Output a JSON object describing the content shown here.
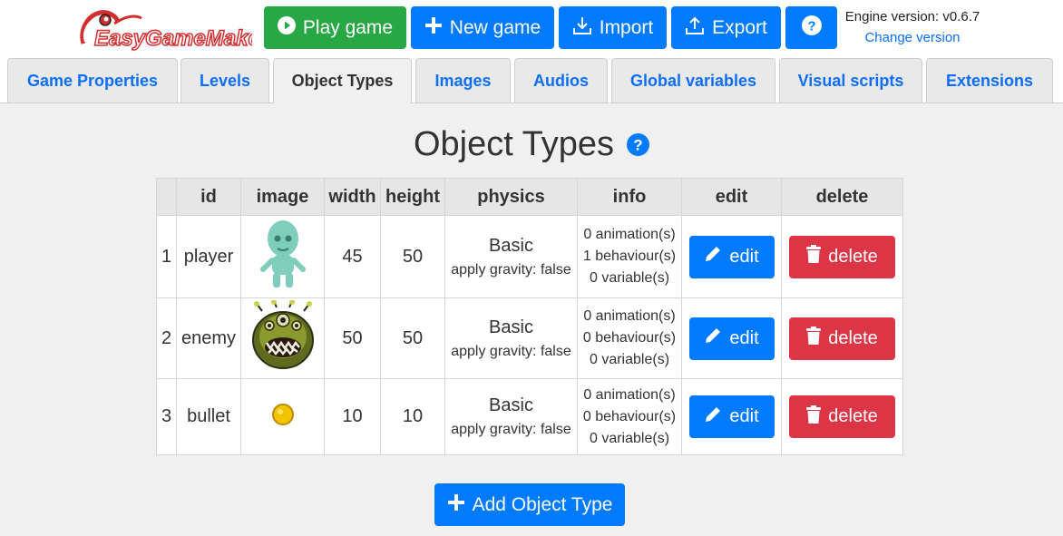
{
  "header": {
    "logo_text": "EasyGameMaker",
    "play_label": "Play game",
    "new_label": "New game",
    "import_label": "Import",
    "export_label": "Export",
    "engine_version": "Engine version: v0.6.7",
    "change_version": "Change version"
  },
  "tabs": [
    {
      "label": "Game Properties",
      "active": false
    },
    {
      "label": "Levels",
      "active": false
    },
    {
      "label": "Object Types",
      "active": true
    },
    {
      "label": "Images",
      "active": false
    },
    {
      "label": "Audios",
      "active": false
    },
    {
      "label": "Global variables",
      "active": false
    },
    {
      "label": "Visual scripts",
      "active": false
    },
    {
      "label": "Extensions",
      "active": false
    }
  ],
  "main": {
    "title": "Object Types",
    "columns": [
      "",
      "id",
      "image",
      "width",
      "height",
      "physics",
      "info",
      "edit",
      "delete"
    ],
    "rows": [
      {
        "index": "1",
        "id": "player",
        "image": "player-sprite",
        "width": "45",
        "height": "50",
        "physics": "Basic",
        "physics_detail": "apply gravity: false",
        "info": [
          "0 animation(s)",
          "1 behaviour(s)",
          "0 variable(s)"
        ],
        "edit_label": "edit",
        "delete_label": "delete"
      },
      {
        "index": "2",
        "id": "enemy",
        "image": "enemy-sprite",
        "width": "50",
        "height": "50",
        "physics": "Basic",
        "physics_detail": "apply gravity: false",
        "info": [
          "0 animation(s)",
          "0 behaviour(s)",
          "0 variable(s)"
        ],
        "edit_label": "edit",
        "delete_label": "delete"
      },
      {
        "index": "3",
        "id": "bullet",
        "image": "bullet-sprite",
        "width": "10",
        "height": "10",
        "physics": "Basic",
        "physics_detail": "apply gravity: false",
        "info": [
          "0 animation(s)",
          "0 behaviour(s)",
          "0 variable(s)"
        ],
        "edit_label": "edit",
        "delete_label": "delete"
      }
    ],
    "add_label": "Add Object Type"
  },
  "icons": {
    "play": "play-circle-icon",
    "new": "plus-icon",
    "import": "download-icon",
    "export": "upload-icon",
    "help": "question-circle-icon",
    "edit": "pencil-icon",
    "delete": "trash-icon"
  },
  "colors": {
    "primary": "#007bff",
    "success": "#28a745",
    "danger": "#dc3545",
    "link": "#0d6efd"
  }
}
